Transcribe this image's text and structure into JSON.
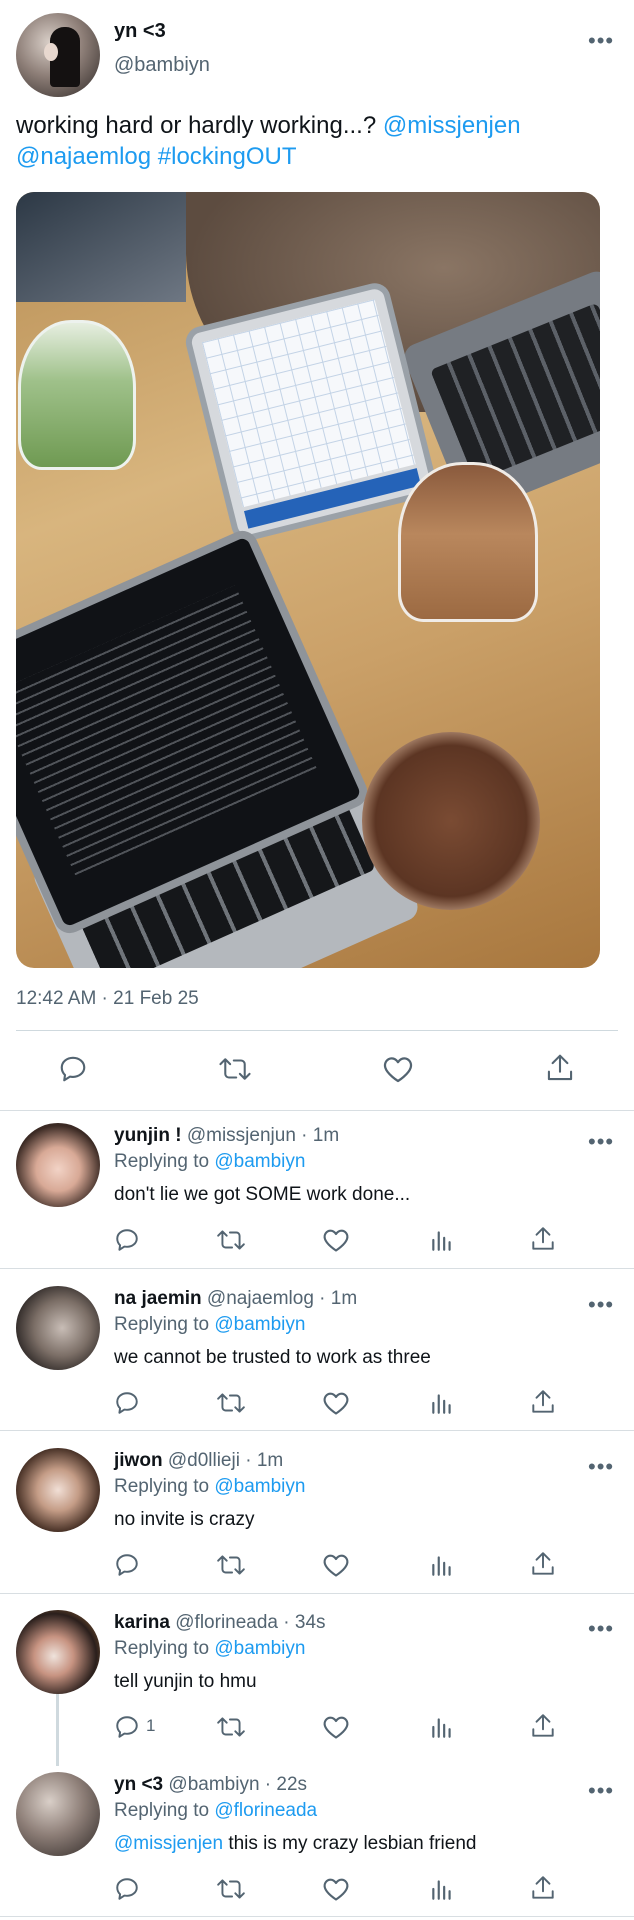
{
  "main_tweet": {
    "display_name": "yn <3",
    "handle": "@bambiyn",
    "text_plain": "working hard or hardly working...? ",
    "mention_1": "@missjenjen",
    "mention_2": "@najaemlog",
    "hashtag": "#lockingOUT",
    "timestamp": "12:42 AM · 21 Feb 25",
    "more_label": "•••",
    "photo_icon": "tweet-photo"
  },
  "action_icons": [
    "reply-icon",
    "retweet-icon",
    "like-icon",
    "views-icon",
    "share-icon"
  ],
  "replies": [
    {
      "name": "yunjin !",
      "handle_time": " @missjenjun · 1m",
      "replying_prefix": "Replying to ",
      "replying_to": "@bambiyn",
      "text": "don't lie we got SOME work done...",
      "reply_count": ""
    },
    {
      "name": "na jaemin",
      "handle_time": " @najaemlog · 1m",
      "replying_prefix": "Replying to ",
      "replying_to": "@bambiyn",
      "text": "we cannot be trusted to work as three",
      "reply_count": ""
    },
    {
      "name": "jiwon",
      "handle_time": " @d0llieji · 1m",
      "replying_prefix": "Replying to ",
      "replying_to": "@bambiyn",
      "text": "no invite is crazy",
      "reply_count": ""
    },
    {
      "name": "karina",
      "handle_time": " @florineada · 34s",
      "replying_prefix": "Replying to ",
      "replying_to": "@bambiyn",
      "text": "tell yunjin to hmu",
      "reply_count": "1"
    },
    {
      "name": "yn <3",
      "handle_time": " @bambiyn · 22s",
      "replying_prefix": "Replying to ",
      "replying_to": "@florineada",
      "text_mention": "@missjenjen",
      "text": " this is my crazy lesbian friend",
      "reply_count": ""
    }
  ],
  "colors": {
    "link": "#1d9bf0",
    "secondary_text": "#536471",
    "divider": "#cfd9de"
  }
}
